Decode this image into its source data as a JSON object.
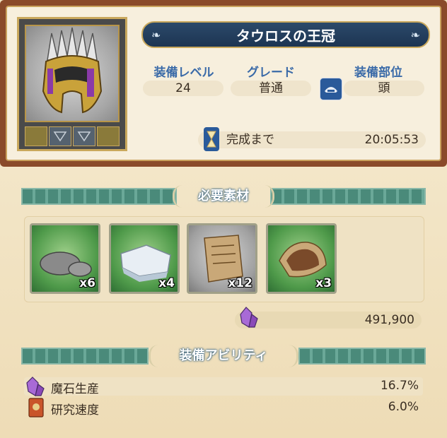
{
  "item": {
    "name": "タウロスの王冠",
    "level_label": "装備レベル",
    "level_value": "24",
    "grade_label": "グレード",
    "grade_value": "普通",
    "slot_label": "装備部位",
    "slot_value": "頭",
    "completion_label": "完成まで",
    "completion_time": "20:05:53",
    "icon": "crowned-helmet-icon"
  },
  "materials": {
    "header": "必要素材",
    "items": [
      {
        "icon": "grey-stone-icon",
        "qty": "x6"
      },
      {
        "icon": "white-crystal-rock-icon",
        "qty": "x4"
      },
      {
        "icon": "old-parchment-icon",
        "qty": "x12"
      },
      {
        "icon": "brown-leather-pelt-icon",
        "qty": "x3"
      }
    ],
    "cost": "491,900",
    "cost_icon": "magicite-crystal-icon"
  },
  "abilities": {
    "header": "装備アビリティ",
    "items": [
      {
        "icon": "magicite-crystal-icon",
        "name": "魔石生産",
        "value": "16.7%"
      },
      {
        "icon": "research-book-icon",
        "name": "研究速度",
        "value": "6.0%"
      }
    ]
  },
  "colors": {
    "frame_brown": "#8a4a2a",
    "title_blue": "#1c3452",
    "label_blue": "#3a6aa8",
    "band_teal": "#4a8a7a"
  }
}
